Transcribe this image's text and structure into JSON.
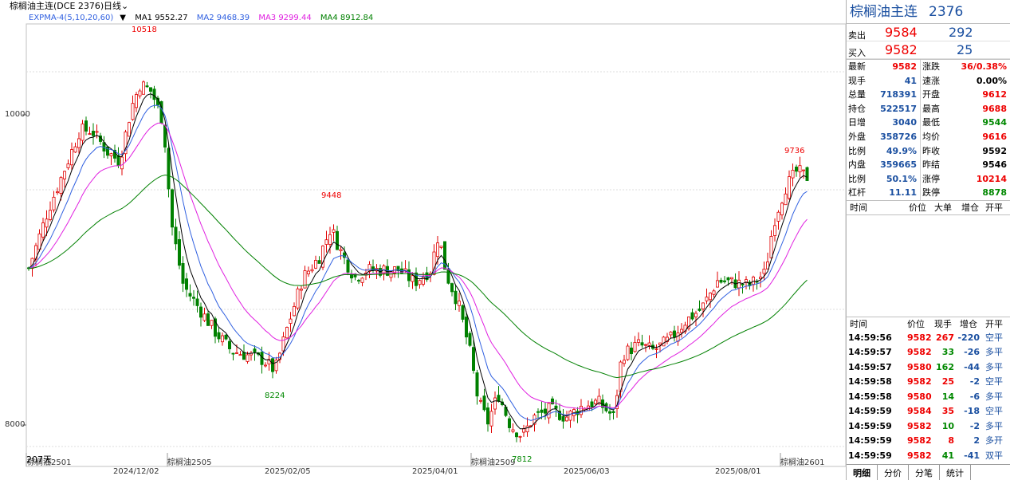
{
  "topbar": {
    "symbol_label": "棕榈油主连(DCE 2376)",
    "period_label": "日线"
  },
  "indicators": {
    "name": "EXPMA-4(5,10,20,60)",
    "ma1": "MA1 9552.27",
    "ma2": "MA2 9468.39",
    "ma3": "MA3 9299.44",
    "ma4": "MA4 8912.84"
  },
  "colors": {
    "up": "#e00000",
    "down": "#008000",
    "ma1": "#000000",
    "ma2": "#3060e0",
    "ma3": "#e020e0",
    "ma4": "#008000"
  },
  "chart_data": {
    "type": "candlestick",
    "y_ticks": [
      "10000",
      "8000"
    ],
    "x_ticks": [
      "2024/12/02",
      "2025/02/05",
      "2025/04/01",
      "2025/06/03",
      "2025/08/01"
    ],
    "contract_labels": [
      "棕榈油2501",
      "棕榈油2505",
      "棕榈油2509",
      "棕榈油2601"
    ],
    "bottom_left_label": "207天",
    "annotations": [
      {
        "text": "10518",
        "color": "red"
      },
      {
        "text": "9448",
        "color": "red"
      },
      {
        "text": "8224",
        "color": "green"
      },
      {
        "text": "7812",
        "color": "green"
      },
      {
        "text": "9736",
        "color": "red"
      }
    ]
  },
  "panel": {
    "title_name": "棕榈油主连",
    "title_code": "2376",
    "sell": {
      "label": "卖出",
      "price": "9584",
      "vol": "292"
    },
    "buy": {
      "label": "买入",
      "price": "9582",
      "vol": "25"
    },
    "stats": [
      {
        "l1": "最新",
        "v1": "9582",
        "c1": "red",
        "l2": "涨跌",
        "v2": "36/0.38%",
        "c2": "red"
      },
      {
        "l1": "现手",
        "v1": "41",
        "c1": "blue",
        "l2": "速涨",
        "v2": "0.00%",
        "c2": "blk"
      },
      {
        "l1": "总量",
        "v1": "718391",
        "c1": "blue",
        "l2": "开盘",
        "v2": "9612",
        "c2": "red"
      },
      {
        "l1": "持仓",
        "v1": "522517",
        "c1": "blue",
        "l2": "最高",
        "v2": "9688",
        "c2": "red"
      },
      {
        "l1": "日增",
        "v1": "3040",
        "c1": "blue",
        "l2": "最低",
        "v2": "9544",
        "c2": "green"
      },
      {
        "l1": "外盘",
        "v1": "358726",
        "c1": "blue",
        "l2": "均价",
        "v2": "9616",
        "c2": "red"
      },
      {
        "l1": "比例",
        "v1": "49.9%",
        "c1": "blue",
        "l2": "昨收",
        "v2": "9592",
        "c2": "blk"
      },
      {
        "l1": "内盘",
        "v1": "359665",
        "c1": "blue",
        "l2": "昨结",
        "v2": "9546",
        "c2": "blk"
      },
      {
        "l1": "比例",
        "v1": "50.1%",
        "c1": "blue",
        "l2": "涨停",
        "v2": "10214",
        "c2": "red"
      },
      {
        "l1": "杠杆",
        "v1": "11.11",
        "c1": "blue",
        "l2": "跌停",
        "v2": "8878",
        "c2": "green"
      }
    ],
    "header1": [
      "时间",
      "价位",
      "大单",
      "增仓",
      "开平"
    ],
    "header2": [
      "时间",
      "价位",
      "现手",
      "增仓",
      "开平"
    ],
    "ticks": [
      {
        "time": "14:59:56",
        "price": "9582",
        "vol": "267",
        "chg": "-220",
        "type": "空平",
        "vc": "red"
      },
      {
        "time": "14:59:57",
        "price": "9582",
        "vol": "33",
        "chg": "-26",
        "type": "多平",
        "vc": "green"
      },
      {
        "time": "14:59:57",
        "price": "9580",
        "vol": "162",
        "chg": "-44",
        "type": "多平",
        "vc": "green"
      },
      {
        "time": "14:59:58",
        "price": "9582",
        "vol": "25",
        "chg": "-2",
        "type": "空平",
        "vc": "red"
      },
      {
        "time": "14:59:58",
        "price": "9580",
        "vol": "14",
        "chg": "-6",
        "type": "多平",
        "vc": "green"
      },
      {
        "time": "14:59:59",
        "price": "9584",
        "vol": "35",
        "chg": "-18",
        "type": "空平",
        "vc": "red"
      },
      {
        "time": "14:59:59",
        "price": "9582",
        "vol": "10",
        "chg": "-2",
        "type": "多平",
        "vc": "green"
      },
      {
        "time": "14:59:59",
        "price": "9582",
        "vol": "8",
        "chg": "2",
        "type": "多开",
        "vc": "red"
      },
      {
        "time": "14:59:59",
        "price": "9582",
        "vol": "41",
        "chg": "-41",
        "type": "双平",
        "vc": "green"
      }
    ],
    "tabs": [
      "明细",
      "分价",
      "分笔",
      "统计"
    ]
  }
}
